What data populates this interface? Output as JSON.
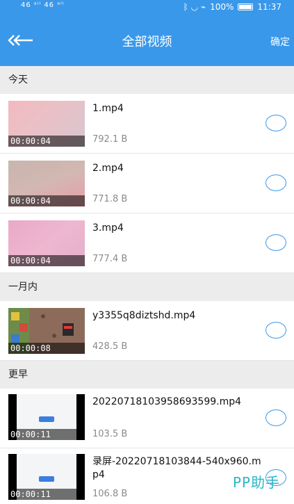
{
  "status_bar": {
    "left": "46 ᵃˡˡ 46 ᵃˡˡ",
    "right_icons": "ᛒ ◡ ⌁",
    "battery": "100%",
    "time": "11:37"
  },
  "app_bar": {
    "title": "全部视频",
    "confirm": "确定"
  },
  "sections": [
    {
      "label": "今天"
    },
    {
      "label": "一月内"
    },
    {
      "label": "更早"
    }
  ],
  "videos": [
    {
      "name": "1.mp4",
      "size": "792.1 B",
      "duration": "00:00:04"
    },
    {
      "name": "2.mp4",
      "size": "771.8 B",
      "duration": "00:00:04"
    },
    {
      "name": "3.mp4",
      "size": "777.4 B",
      "duration": "00:00:04"
    },
    {
      "name": "y3355q8diztshd.mp4",
      "size": "428.5 B",
      "duration": "00:00:08"
    },
    {
      "name": "20220718103958693599.mp4",
      "size": "103.5 B",
      "duration": "00:00:11"
    },
    {
      "name": "录屏-20220718103844-540x960.mp4",
      "size": "106.8 B",
      "duration": "00:00:11"
    }
  ],
  "watermark": "PP助手",
  "colors": {
    "accent": "#3a98ea",
    "section_bg": "#ececec"
  }
}
